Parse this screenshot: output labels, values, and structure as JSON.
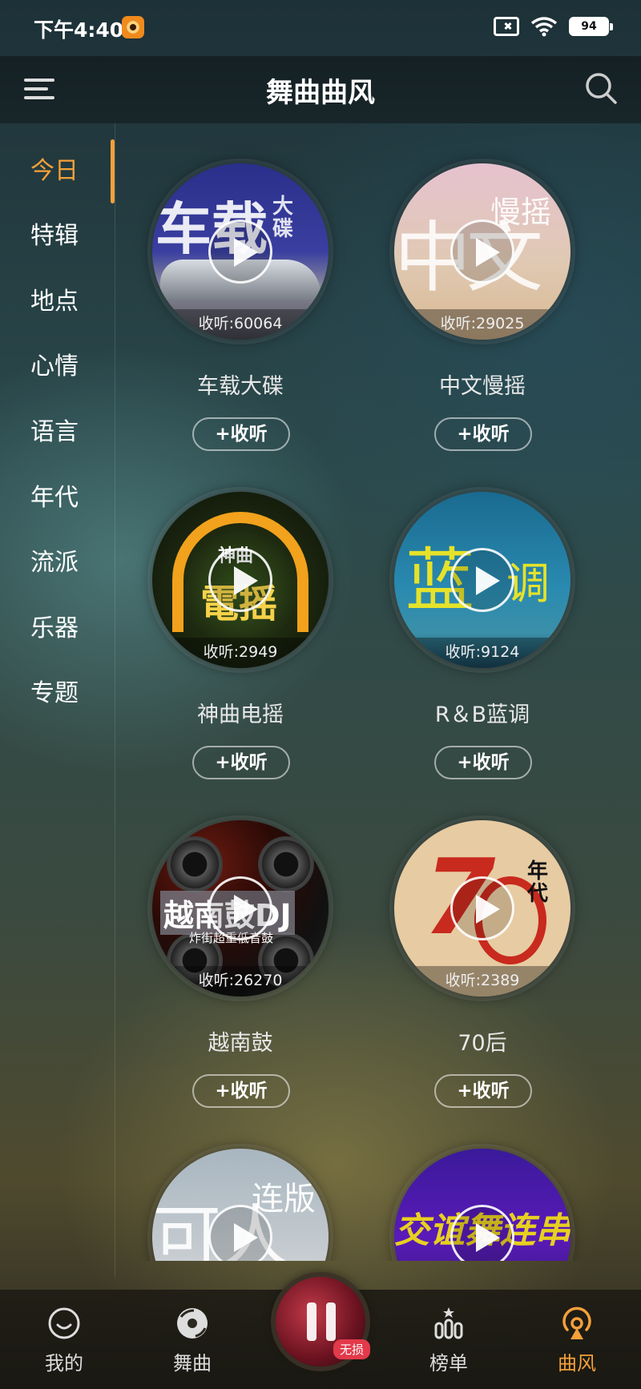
{
  "status_bar": {
    "time": "下午4:40",
    "battery": "94"
  },
  "header": {
    "title": "舞曲曲风"
  },
  "sidebar": {
    "items": [
      {
        "label": "今日"
      },
      {
        "label": "特辑"
      },
      {
        "label": "地点"
      },
      {
        "label": "心情"
      },
      {
        "label": "语言"
      },
      {
        "label": "年代"
      },
      {
        "label": "流派"
      },
      {
        "label": "乐器"
      },
      {
        "label": "专题"
      }
    ],
    "active": "今日"
  },
  "cards": [
    {
      "title": "车载大碟",
      "plays": "收听:60064",
      "button": "+收听",
      "art_text": "车载",
      "art_sub": "大碟"
    },
    {
      "title": "中文慢摇",
      "plays": "收听:29025",
      "button": "+收听",
      "art_text": "中文",
      "art_sub": "慢摇"
    },
    {
      "title": "神曲电摇",
      "plays": "收听:2949",
      "button": "+收听",
      "art_text": "電摇",
      "art_sub": "神曲"
    },
    {
      "title": "R＆B蓝调",
      "plays": "收听:9124",
      "button": "+收听",
      "art_text": "蓝",
      "art_sub": "调"
    },
    {
      "title": "越南鼓",
      "plays": "收听:26270",
      "button": "+收听",
      "art_text": "越南鼓DJ",
      "art_sub": "炸街超重低音鼓"
    },
    {
      "title": "70后",
      "plays": "收听:2389",
      "button": "+收听",
      "art_text": "7",
      "art_sub": "年代"
    },
    {
      "title": "",
      "plays": "",
      "button": "",
      "art_text": "可人",
      "art_sub": "连版"
    },
    {
      "title": "",
      "plays": "",
      "button": "",
      "art_text": "交谊舞连串",
      "art_sub": ""
    }
  ],
  "bottom_nav": {
    "items": [
      {
        "label": "我的",
        "icon": "smile-icon"
      },
      {
        "label": "舞曲",
        "icon": "disc-icon"
      },
      {
        "label": "榜单",
        "icon": "chart-icon"
      },
      {
        "label": "曲风",
        "icon": "broadcast-icon"
      }
    ],
    "active": "曲风",
    "now_playing_badge": "无损"
  },
  "colors": {
    "accent": "#f5a03a",
    "badge": "#e23a4a"
  }
}
